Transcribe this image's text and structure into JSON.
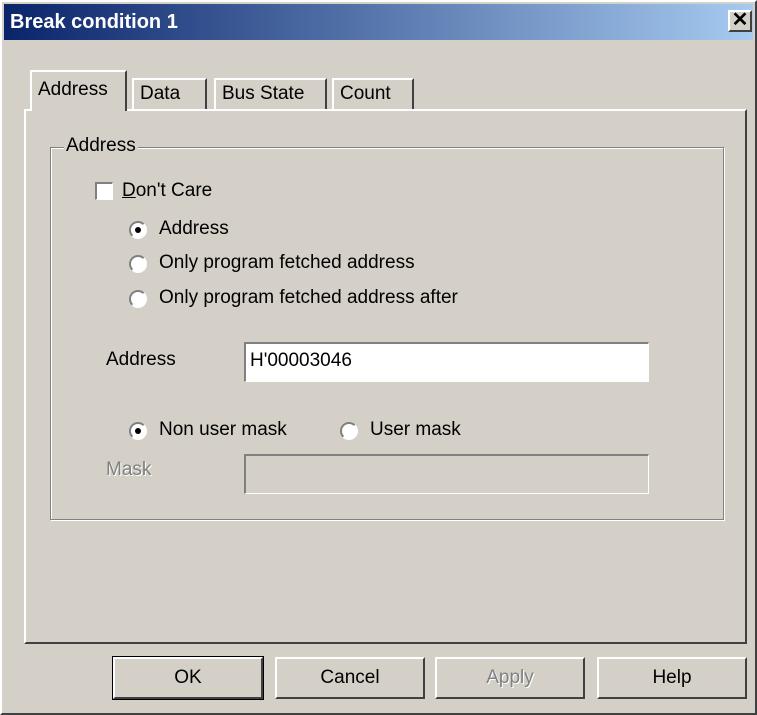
{
  "window": {
    "title": "Break condition 1",
    "close_glyph": "✕"
  },
  "tabs": [
    {
      "label": "Address",
      "active": true
    },
    {
      "label": "Data",
      "active": false
    },
    {
      "label": "Bus State",
      "active": false
    },
    {
      "label": "Count",
      "active": false
    }
  ],
  "address_group": {
    "legend": "Address",
    "dont_care": {
      "label": "Don't Care",
      "checked": false
    },
    "address_mode": {
      "options": [
        "Address",
        "Only program fetched address",
        "Only program fetched address after"
      ],
      "selected_index": 0
    },
    "address_field": {
      "label": "Address",
      "value": "H'00003046"
    },
    "mask_mode": {
      "options": [
        "Non user mask",
        "User mask"
      ],
      "selected_index": 0
    },
    "mask_field": {
      "label": "Mask",
      "value": "",
      "enabled": false
    }
  },
  "buttons": {
    "ok": "OK",
    "cancel": "Cancel",
    "apply": "Apply",
    "help": "Help"
  },
  "colors": {
    "face": "#d4d0c8",
    "title_start": "#0a246a",
    "title_end": "#a6caf0",
    "disabled": "#808080"
  },
  "icons": {
    "close": "close-icon"
  }
}
